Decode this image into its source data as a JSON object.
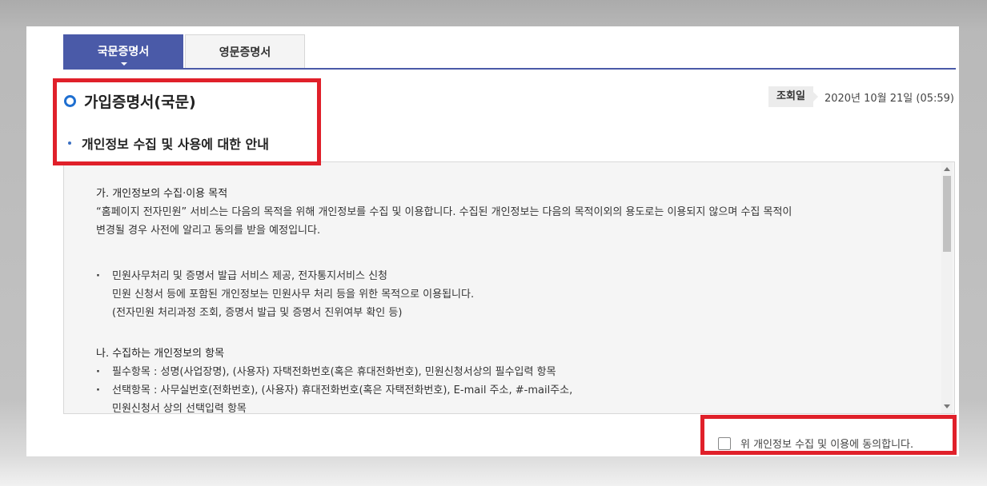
{
  "tabs": [
    {
      "label": "국문증명서",
      "active": true
    },
    {
      "label": "영문증명서",
      "active": false
    }
  ],
  "title": "가입증명서(국문)",
  "subtitle": "개인정보 수집 및 사용에 대한 안내",
  "date": {
    "label": "조회일",
    "value": "2020년 10월 21일 (05:59)"
  },
  "terms": {
    "section1_title": "가. 개인정보의 수집·이용 목적",
    "section1_lines": [
      "“홈페이지 전자민원” 서비스는 다음의 목적을 위해 개인정보를 수집 및 이용합니다. 수집된 개인정보는 다음의 목적이외의 용도로는 이용되지 않으며 수집 목적이",
      "변경될 경우 사전에 알리고 동의를 받을 예정입니다."
    ],
    "purpose_lines": [
      "민원사무처리 및 증명서 발급 서비스 제공, 전자통지서비스 신청",
      "민원 신청서 등에 포함된 개인정보는 민원사무 처리 등을 위한 목적으로 이용됩니다.",
      "(전자민원 처리과정 조회, 증명서 발급 및 증명서 진위여부 확인 등)"
    ],
    "section2_title": "나. 수집하는 개인정보의 항목",
    "required": "필수항목 : 성명(사업장명), (사용자) 자택전화번호(혹은 휴대전화번호), 민원신청서상의 필수입력 항목",
    "optional_lines": [
      "선택항목 : 사무실번호(전화번호), (사용자) 휴대전화번호(혹은 자택전화번호), E-mail 주소, #-mail주소,",
      "민원신청서 상의 선택입력 항목"
    ]
  },
  "agree_label": "위 개인정보 수집 및 이용에 동의합니다.",
  "colors": {
    "accent": "#4a5aa8",
    "highlight": "#e0202a",
    "icon_blue": "#1f6fd0"
  }
}
